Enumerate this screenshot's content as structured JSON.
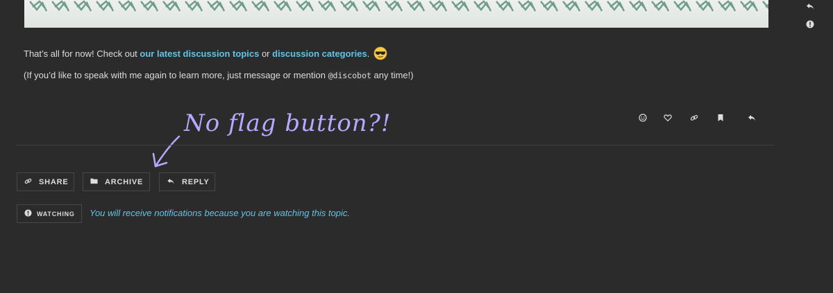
{
  "banner": {
    "name": "decorative-pattern-banner"
  },
  "side_icons": [
    "reply-icon",
    "info-icon"
  ],
  "post": {
    "line1_prefix": "That’s all for now! Check out ",
    "link_latest": "our latest discussion topics",
    "line1_mid": " or ",
    "link_categories": "discussion categories",
    "line1_suffix": ".",
    "emoji": "sunglasses-emoji",
    "line2_prefix": "(If you’d like to speak with me again to learn more, just message or mention ",
    "mention": "@discobot",
    "line2_suffix": " any time!)"
  },
  "post_actions": [
    "smile-icon",
    "heart-icon",
    "link-icon",
    "bookmark-icon",
    "reply-icon"
  ],
  "annotation": "No flag button?!",
  "topic_buttons": {
    "share": "SHARE",
    "archive": "ARCHIVE",
    "reply": "REPLY"
  },
  "notifications": {
    "button": "WATCHING",
    "text": "You will receive notifications because you are watching this topic."
  },
  "colors": {
    "background": "#2b2b2b",
    "link": "#61c3e8",
    "text": "#dddddd",
    "annotation": "#b7a9ff"
  }
}
